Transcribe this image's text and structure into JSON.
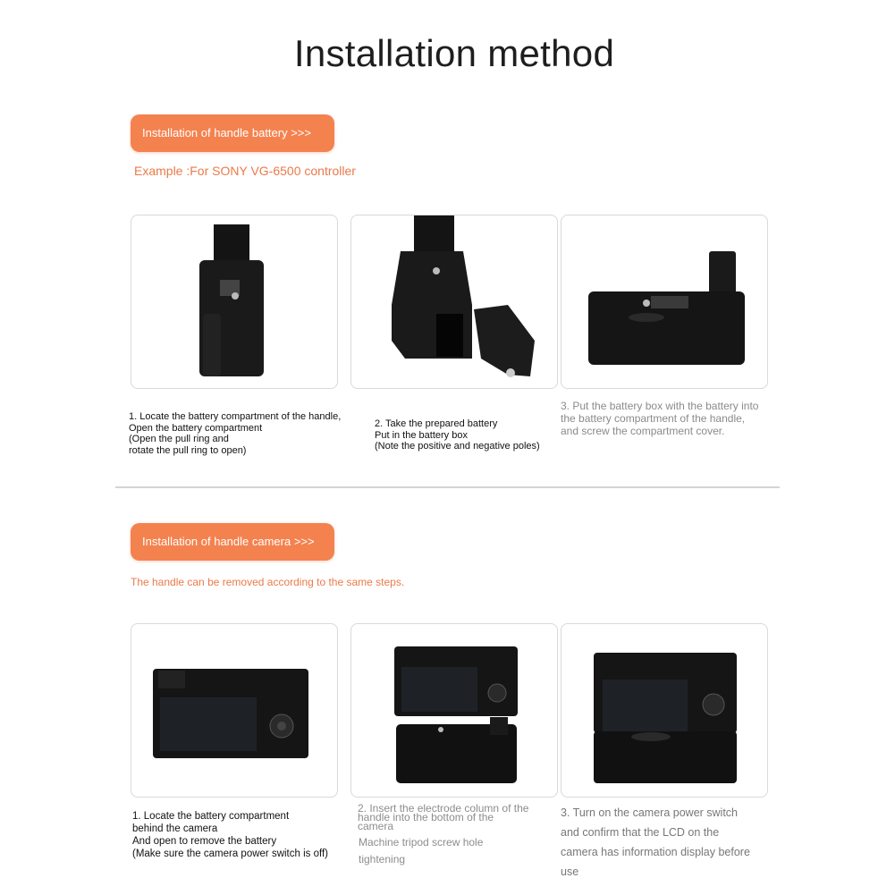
{
  "page": {
    "title": "Installation method"
  },
  "section1": {
    "button_label": "Installation of handle battery >>>",
    "subtitle": "Example :For SONY VG-6500 controller",
    "steps": [
      {
        "image": "battery-grip-handle-upright",
        "caption": "1. Locate the battery compartment of the handle,\nOpen the battery compartment\n(Open the pull ring and\nrotate the pull ring to open)"
      },
      {
        "image": "battery-grip-compartment-open",
        "caption": "2. Take the prepared battery\nPut in the battery box\n(Note the positive and negative poles)"
      },
      {
        "image": "battery-grip-with-battery",
        "caption": "3. Put the battery box with the battery into\nthe battery compartment of the handle,\nand screw the compartment cover."
      }
    ]
  },
  "section2": {
    "button_label": "Installation of handle camera >>>",
    "subtitle": "The handle can be removed according to the same steps.",
    "steps": [
      {
        "image": "camera-rear-view",
        "caption": "1. Locate the battery compartment\nbehind the camera\nAnd open to remove the battery\n(Make sure the camera power switch is off)"
      },
      {
        "image": "camera-above-battery-grip",
        "caption": "2. Insert the electrode column of the\nhandle into the bottom of the\ncamera",
        "caption_extra": "Machine tripod screw hole\ntightening"
      },
      {
        "image": "camera-mounted-on-grip",
        "caption": "3. Turn on the camera power switch\nand confirm that the LCD on the\ncamera has information display before\nuse"
      }
    ]
  },
  "colors": {
    "accent": "#f4824f",
    "accent_text": "#ea7a4a",
    "card_border": "#d9d9d9",
    "divider": "#d4d4d4"
  }
}
